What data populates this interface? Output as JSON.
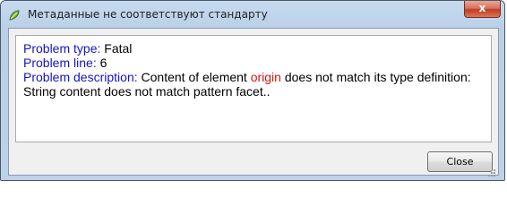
{
  "window": {
    "title": "Метаданные не соответствуют стандарту",
    "close_glyph": "x"
  },
  "message": {
    "problem_type_label": "Problem type:",
    "problem_type_value": "Fatal",
    "problem_line_label": "Problem line:",
    "problem_line_value": "6",
    "problem_description_label": "Problem description:",
    "description_part1": "Content of element",
    "element_name": "origin",
    "description_part2": "does not match its type definition: String content does not match pattern facet.."
  },
  "buttons": {
    "close_label": "Close"
  },
  "colors": {
    "label": "#1414c8",
    "highlight": "#d41414"
  },
  "icons": {
    "app": "qgis-icon",
    "titlebar_close": "close-icon",
    "resize": "resize-grip-icon"
  }
}
